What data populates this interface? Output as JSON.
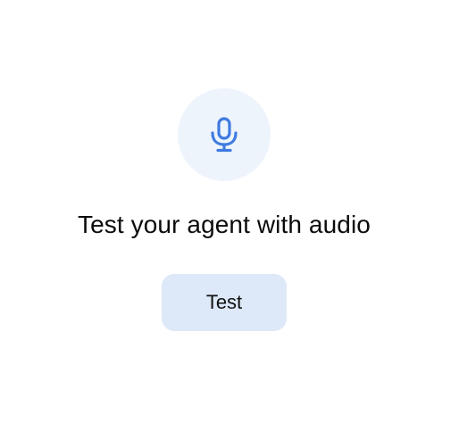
{
  "prompt": {
    "icon": "microphone-icon",
    "title": "Test your agent with audio",
    "button_label": "Test"
  },
  "colors": {
    "accent": "#3f7be0",
    "circle_background": "#eef4fc",
    "button_background": "#dde8f8",
    "text": "#0b0b0b"
  }
}
